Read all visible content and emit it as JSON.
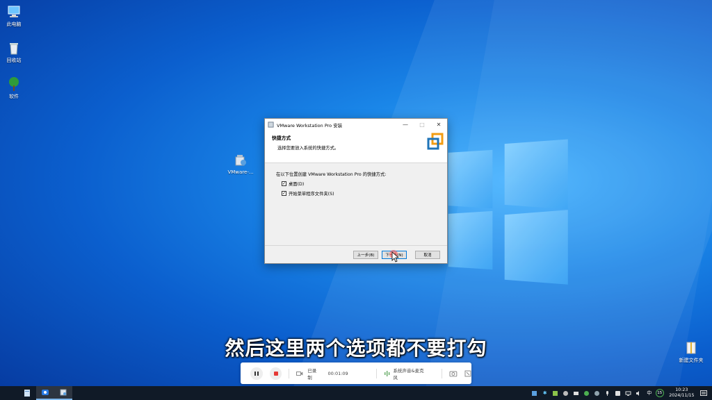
{
  "desktop": {
    "icons": [
      {
        "label": "此电脑",
        "icon": "computer-icon"
      },
      {
        "label": "回收站",
        "icon": "recycle-bin-icon"
      },
      {
        "label": "软件",
        "icon": "tree-icon"
      },
      {
        "label": "VMware-...",
        "icon": "installer-icon"
      },
      {
        "label": "新建文件夹",
        "icon": "archive-icon"
      }
    ]
  },
  "dialog": {
    "title": "VMware Workstation Pro 安装",
    "header_title": "快捷方式",
    "header_subtitle": "选择您要放入系统的快捷方式。",
    "instruction": "在以下位置创建 VMware Workstation Pro 的快捷方式:",
    "options": [
      {
        "label": "桌面(D)",
        "checked": true
      },
      {
        "label": "开始菜单程序文件夹(S)",
        "checked": true
      }
    ],
    "buttons": {
      "back": "上一步(B)",
      "next": "下一步(N)",
      "cancel": "取消"
    },
    "window_controls": {
      "minimize": "—",
      "maximize": "□",
      "close": "✕"
    }
  },
  "subtitle": "然后这里两个选项都不要打勾",
  "recorder": {
    "status": "已录制",
    "time": "00:01:09",
    "audio": "系统声音&麦克风"
  },
  "taskbar": {
    "ime": "中",
    "badge": "15",
    "time": "10:23",
    "date": "2024/11/15"
  },
  "colors": {
    "accent": "#0078d7",
    "desktop": "#1a86e8",
    "taskbar": "#101a27",
    "record": "#e53935"
  }
}
